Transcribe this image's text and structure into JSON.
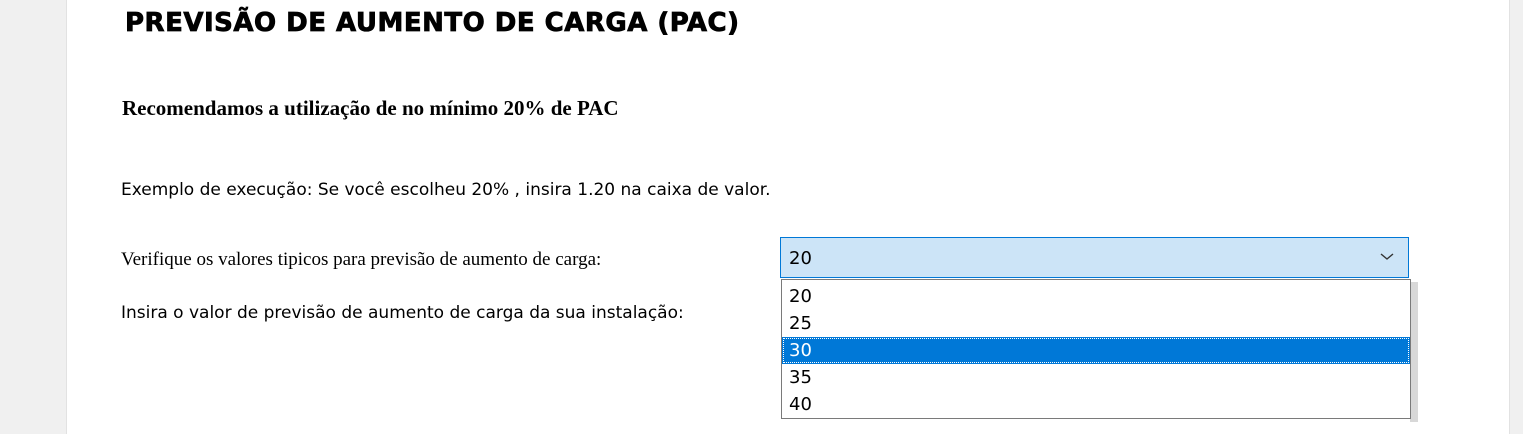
{
  "section": {
    "title": "PREVISÃO DE AUMENTO DE CARGA (PAC)",
    "recommendation": "Recomendamos a utilização de no mínimo 20% de PAC",
    "example": "Exemplo de execução: Se você escolheu 20% , insira 1.20 na caixa de valor.",
    "verify_label": "Verifique os valores tipicos para previsão de aumento de carga:",
    "insert_label": "Insira o valor de previsão de aumento de carga da sua instalação:"
  },
  "select": {
    "value": "20",
    "options": [
      "20",
      "25",
      "30",
      "35",
      "40"
    ],
    "highlighted": "30",
    "icon": "chevron-down-icon"
  },
  "colors": {
    "highlight": "#0078d7",
    "select_bg": "#cce4f7"
  }
}
